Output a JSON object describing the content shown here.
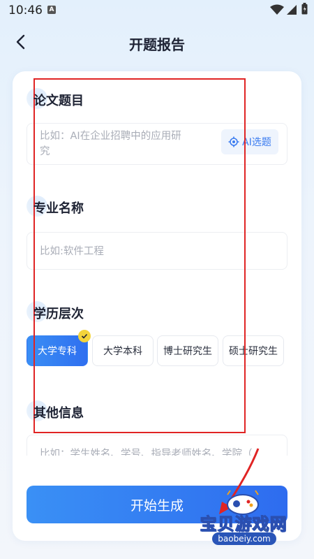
{
  "status_bar": {
    "time": "10:46",
    "notification": "A"
  },
  "header": {
    "title": "开题报告"
  },
  "form": {
    "topic": {
      "title": "论文题目",
      "placeholder_line1": "比如：AI在企业招聘中的应用研",
      "placeholder_line2": "究",
      "ai_button_label": "AI选题"
    },
    "major": {
      "title": "专业名称",
      "placeholder": "比如:软件工程"
    },
    "education": {
      "title": "学历层次",
      "options": [
        "大学专科",
        "大学本科",
        "博士研究生",
        "硕士研究生"
      ],
      "selected": "大学专科"
    },
    "other": {
      "title": "其他信息",
      "placeholder": "比如：学生姓名、学号、指导老师姓名、学院（"
    }
  },
  "generate_button": {
    "label": "开始生成"
  },
  "watermark": {
    "title": "宝贝游戏网",
    "url": "baobeiy.com"
  },
  "colors": {
    "primary": "#2f6ff0",
    "accent_yellow": "#f3d43b",
    "annotation_red": "#e02424"
  }
}
